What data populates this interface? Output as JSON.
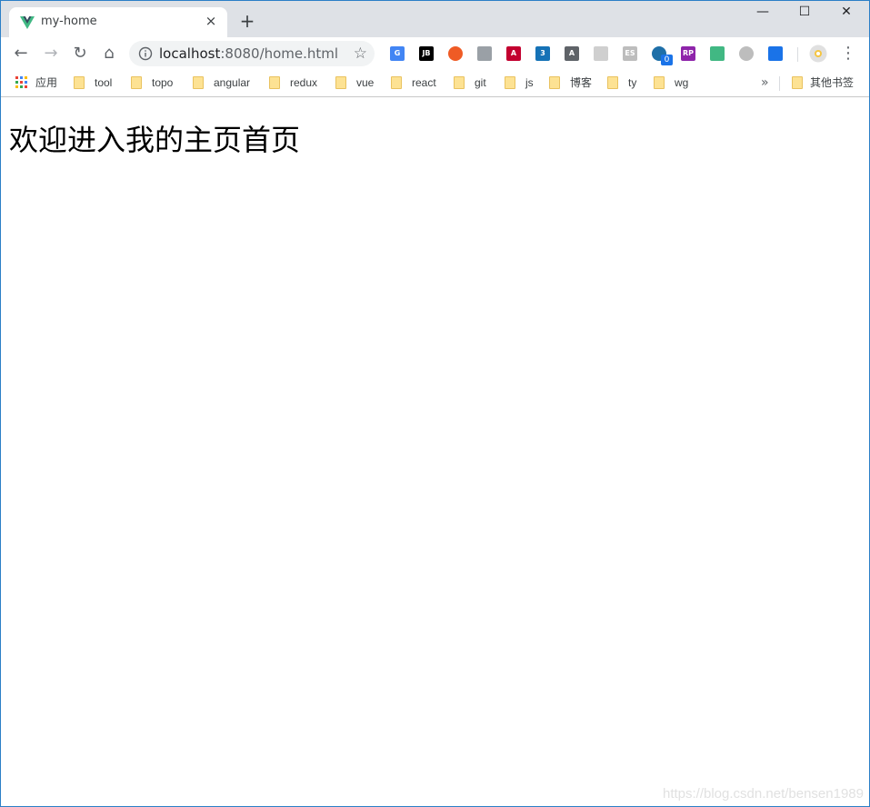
{
  "tab": {
    "title": "my-home",
    "favicon": "vue-icon",
    "close_label": "×"
  },
  "window_controls": {
    "minimize": "—",
    "maximize": "☐",
    "close": "✕"
  },
  "toolbar": {
    "url_host": "localhost",
    "url_rest": ":8080/home.html",
    "extensions": [
      {
        "name": "google-translate-icon",
        "label": "G",
        "color": "#4285f4"
      },
      {
        "name": "jetbrains-icon",
        "label": "JB",
        "color": "#000000"
      },
      {
        "name": "postman-icon",
        "label": "",
        "color": "#ef5b25"
      },
      {
        "name": "shield-extension-icon",
        "label": "",
        "color": "#9aa0a6"
      },
      {
        "name": "angular-icon",
        "label": "A",
        "color": "#c3002f"
      },
      {
        "name": "css3-icon",
        "label": "3",
        "color": "#1572b6"
      },
      {
        "name": "font-a-icon",
        "label": "A",
        "color": "#5f6368"
      },
      {
        "name": "react-devtools-icon",
        "label": "",
        "color": "#cfcfcf"
      },
      {
        "name": "es-extension-icon",
        "label": "ES",
        "color": "#bdbdbd"
      },
      {
        "name": "blue-circle-extension-icon",
        "label": "",
        "color": "#1e6fa8"
      },
      {
        "name": "rp-extension-icon",
        "label": "RP",
        "color": "#8e24aa"
      },
      {
        "name": "vue-devtools-icon",
        "label": "",
        "color": "#41b883"
      },
      {
        "name": "grey-circle-extension-icon",
        "label": "",
        "color": "#bdbdbd"
      },
      {
        "name": "download-extension-icon",
        "label": "",
        "color": "#1a73e8"
      }
    ],
    "badge_count": "0"
  },
  "bookmarks": {
    "apps_label": "应用",
    "items": [
      "tool",
      "topo",
      "angular",
      "redux",
      "vue",
      "react",
      "git",
      "js",
      "博客",
      "ty",
      "wg"
    ],
    "more_label": "»",
    "other_label": "其他书签"
  },
  "page": {
    "heading": "欢迎进入我的主页首页",
    "watermark": "https://blog.csdn.net/bensen1989"
  }
}
